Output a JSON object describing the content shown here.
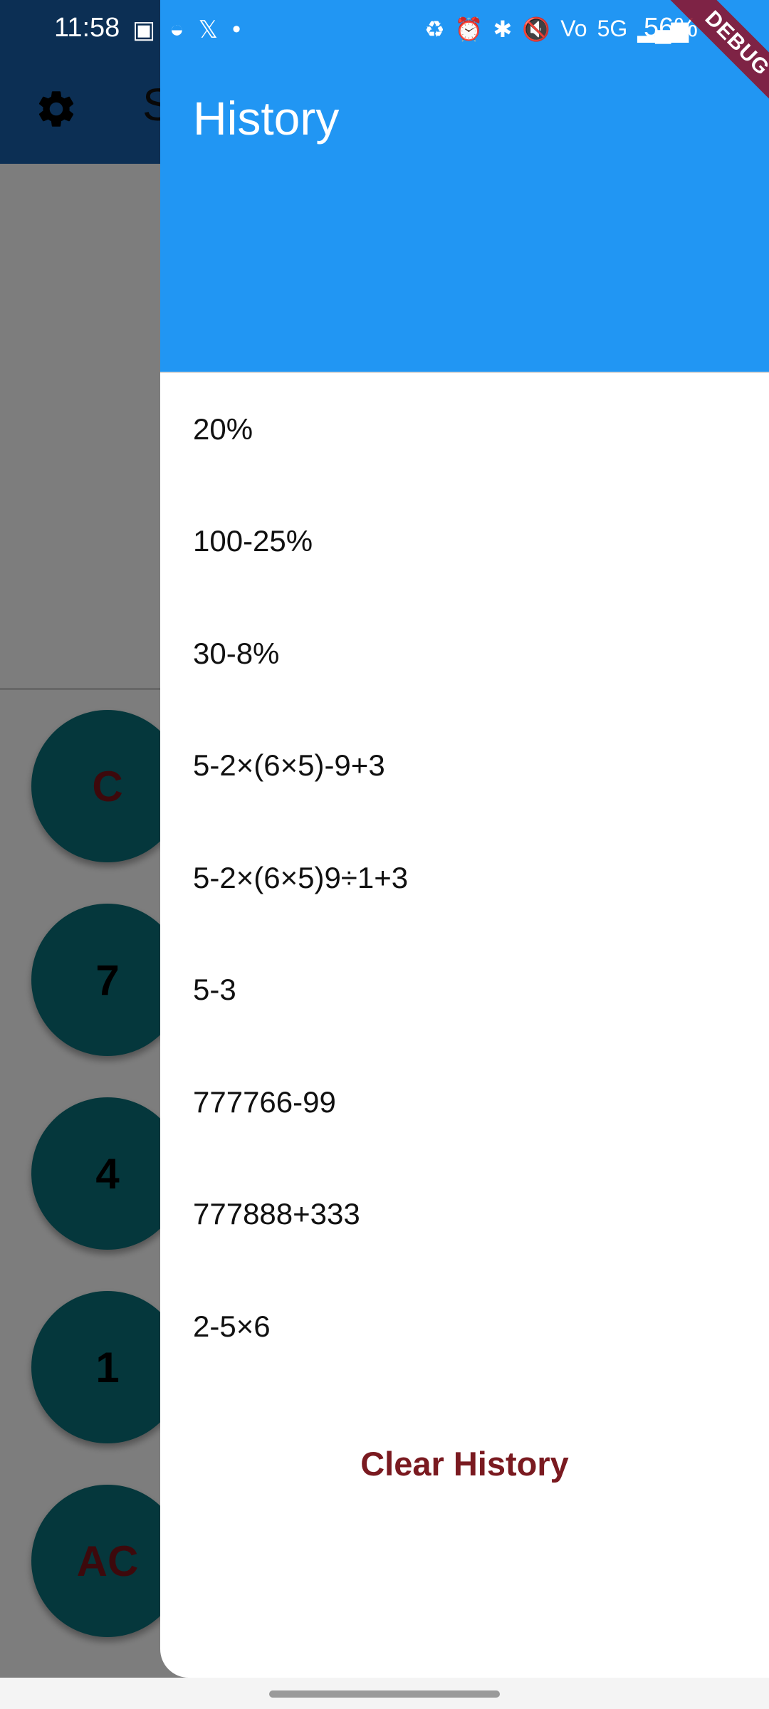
{
  "status_bar": {
    "time": "11:58",
    "battery": "56%",
    "left_icons": [
      "image-icon",
      "app-icon",
      "x-logo-icon",
      "dot-icon"
    ],
    "right_icons": [
      "sync-icon",
      "alarm-icon",
      "bluetooth-icon",
      "mute-icon",
      "volte-icon",
      "5g-icon",
      "signal-icon"
    ]
  },
  "app_bar": {
    "title_partial": "S"
  },
  "keypad": {
    "keys": [
      "C",
      "7",
      "4",
      "1",
      "AC"
    ]
  },
  "drawer": {
    "title": "History",
    "history": [
      "20%",
      "100-25%",
      "30-8%",
      "5-2×(6×5)-9+3",
      "5-2×(6×5)9÷1+3",
      "5-3",
      "777766-99",
      "777888+333",
      "2-5×6"
    ],
    "clear_label": "Clear History"
  },
  "debug_banner": "DEBUG",
  "colors": {
    "drawer_header": "#2196f3",
    "app_bar": "#195ea8",
    "key_bg": "#0a6f78",
    "clear_text": "#7a1a20"
  }
}
